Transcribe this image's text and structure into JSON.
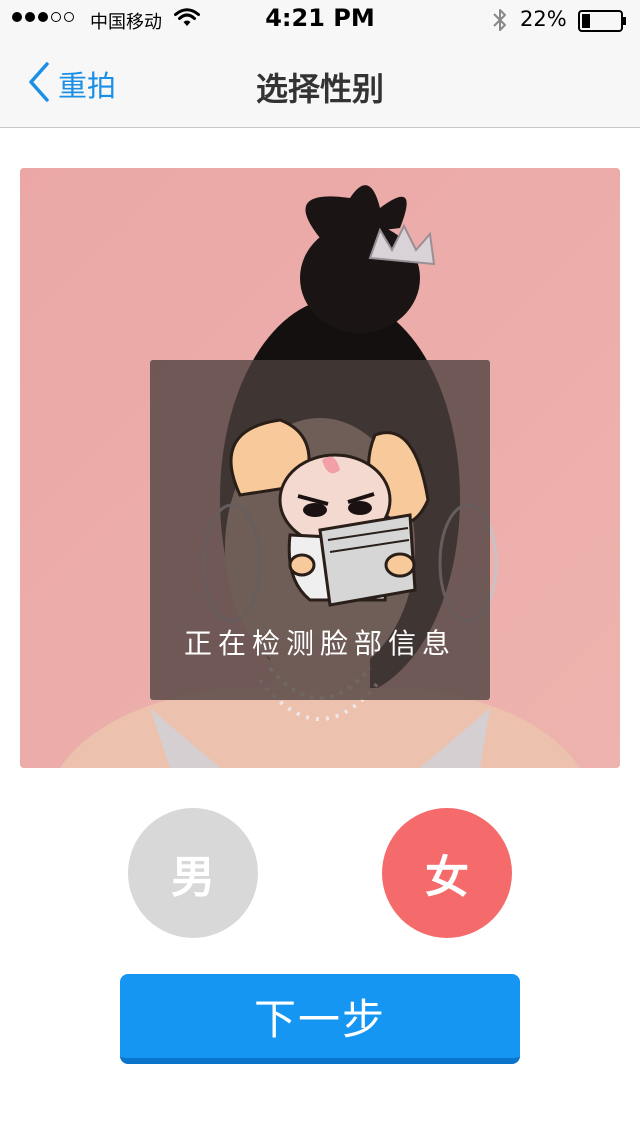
{
  "status_bar": {
    "signal_bars_filled": 3,
    "signal_bars_total": 5,
    "carrier": "中国移动",
    "time": "4:21 PM",
    "battery_percent": "22%",
    "battery_level": 0.22,
    "icons": [
      "wifi-icon",
      "bluetooth-icon",
      "battery-icon"
    ]
  },
  "nav": {
    "back_label": "重拍",
    "title": "选择性别",
    "accent_color": "#1a8fe6"
  },
  "photo": {
    "overlay_text": "正在检测脸部信息",
    "mascot": "cartoon-dog-reading-icon"
  },
  "gender": {
    "male_label": "男",
    "female_label": "女",
    "selected": "female",
    "male_color": "#d8d8d8",
    "female_color": "#f56b6b"
  },
  "next": {
    "label": "下一步",
    "color": "#1596f3"
  }
}
